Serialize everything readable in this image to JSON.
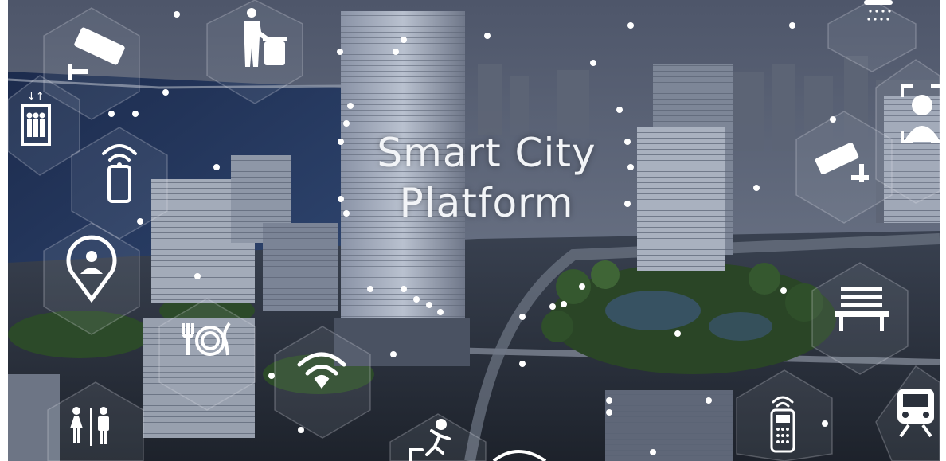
{
  "image": {
    "title_lines": [
      "Smart City",
      "Platform"
    ],
    "palette": {
      "sky_top": "#5c6478",
      "sky_bottom": "#7d8595",
      "water": "#1f3358",
      "building": "#9aa3b2",
      "building_dark": "#3a4250",
      "greenery": "#2e4a2a",
      "icon_white": "#ffffff",
      "hex_overlay": "#c9ced8"
    },
    "icons": [
      "cctv-camera-icon",
      "trash-bin-icon",
      "elevator-icon",
      "smartphone-wifi-icon",
      "location-person-icon",
      "dining-icon",
      "wifi-icon",
      "restroom-icon",
      "running-exit-icon",
      "rain-cloud-icon",
      "face-scan-icon",
      "cctv-camera-icon",
      "bench-icon",
      "remote-control-wifi-icon",
      "train-icon"
    ]
  }
}
